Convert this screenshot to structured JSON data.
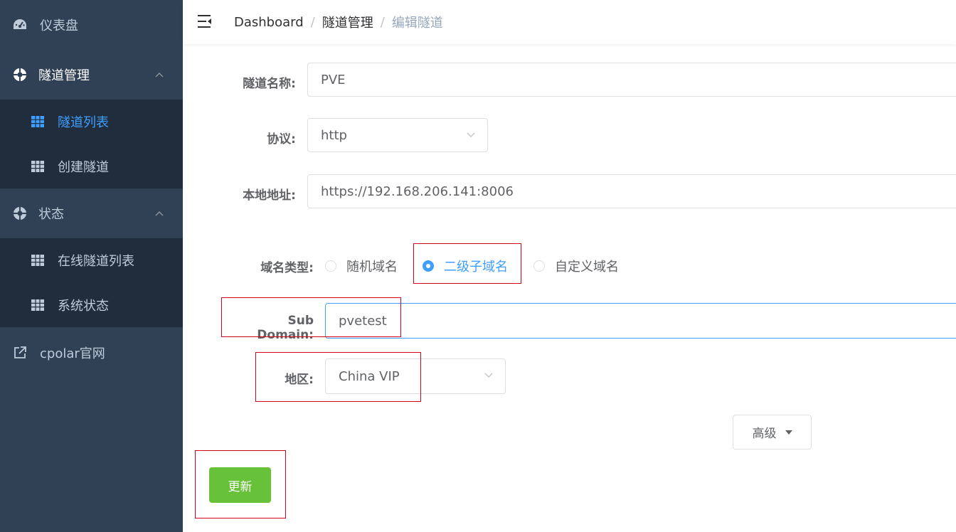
{
  "sidebar": {
    "items": [
      {
        "label": "仪表盘",
        "icon": "dashboard-icon"
      },
      {
        "label": "隧道管理",
        "icon": "lifebuoy-icon",
        "expanded": true,
        "children": [
          {
            "label": "隧道列表",
            "icon": "table-icon",
            "active": true
          },
          {
            "label": "创建隧道",
            "icon": "table-icon"
          }
        ]
      },
      {
        "label": "状态",
        "icon": "lifebuoy-icon",
        "expanded": true,
        "children": [
          {
            "label": "在线隧道列表",
            "icon": "table-icon"
          },
          {
            "label": "系统状态",
            "icon": "table-icon"
          }
        ]
      },
      {
        "label": "cpolar官网",
        "icon": "external-link-icon"
      }
    ]
  },
  "header": {
    "breadcrumbs": [
      "Dashboard",
      "隧道管理",
      "编辑隧道"
    ],
    "separator": "/"
  },
  "form": {
    "name_label": "隧道名称:",
    "name_value": "PVE",
    "protocol_label": "协议:",
    "protocol_value": "http",
    "local_label": "本地地址:",
    "local_value": "https://192.168.206.141:8006",
    "domain_type_label": "域名类型:",
    "domain_types": [
      "随机域名",
      "二级子域名",
      "自定义域名"
    ],
    "domain_type_selected": "二级子域名",
    "subdomain_label": "Sub Domain:",
    "subdomain_value": "pvetest",
    "region_label": "地区:",
    "region_value": "China VIP",
    "advanced_label": "高级",
    "update_label": "更新"
  },
  "colors": {
    "sidebar_bg": "#304156",
    "submenu_bg": "#1f2d3d",
    "active": "#409eff",
    "success": "#67c23a",
    "highlight": "#d9001b"
  }
}
